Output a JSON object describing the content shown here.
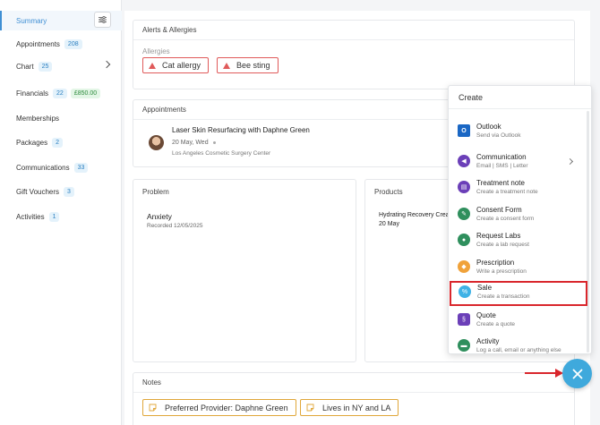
{
  "sidebar": {
    "items": [
      {
        "label": "Summary"
      },
      {
        "label": "Appointments",
        "badge": "208"
      },
      {
        "label": "Chart",
        "badge": "25"
      },
      {
        "label": "Financials",
        "badge": "22",
        "badge2": "£850.00"
      },
      {
        "label": "Memberships"
      },
      {
        "label": "Packages",
        "badge": "2"
      },
      {
        "label": "Communications",
        "badge": "33"
      },
      {
        "label": "Gift Vouchers",
        "badge": "3"
      },
      {
        "label": "Activities",
        "badge": "1"
      }
    ]
  },
  "alerts": {
    "title": "Alerts & Allergies",
    "subtitle": "Allergies",
    "tags": [
      "Cat allergy",
      "Bee sting"
    ]
  },
  "appointments": {
    "title": "Appointments",
    "item": {
      "name": "Laser Skin Resurfacing with Daphne Green",
      "date": "20 May, Wed",
      "location": "Los Angeles Cosmetic Surgery Center"
    }
  },
  "problem": {
    "title": "Problem",
    "name": "Anxiety",
    "recorded": "Recorded 12/05/2025"
  },
  "products": {
    "title": "Products",
    "name": "Hydrating Recovery Cream",
    "date": "20 May"
  },
  "notes": {
    "title": "Notes",
    "tags": [
      "Preferred Provider: Daphne Green",
      "Lives in NY and LA"
    ]
  },
  "create_menu": {
    "title": "Create",
    "items": [
      {
        "title": "Outlook",
        "sub": "Send via Outlook",
        "color": "#1a67c4"
      },
      {
        "title": "Communication",
        "sub": "Email | SMS | Letter",
        "color": "#6b3fb8"
      },
      {
        "title": "Treatment note",
        "sub": "Create a treatment note",
        "color": "#6b3fb8"
      },
      {
        "title": "Consent Form",
        "sub": "Create a consent form",
        "color": "#2f8f5d"
      },
      {
        "title": "Request Labs",
        "sub": "Create a lab request",
        "color": "#2f8f5d"
      },
      {
        "title": "Prescription",
        "sub": "Write a prescription",
        "color": "#f0a23a"
      },
      {
        "title": "Sale",
        "sub": "Create a transaction",
        "color": "#3fb2e6"
      },
      {
        "title": "Quote",
        "sub": "Create a quote",
        "color": "#6b3fb8"
      },
      {
        "title": "Activity",
        "sub": "Log a call, email or anything else",
        "color": "#2f8f5d"
      }
    ],
    "highlight_color": "#d9262c"
  },
  "accent_color": "#3fa9dc"
}
